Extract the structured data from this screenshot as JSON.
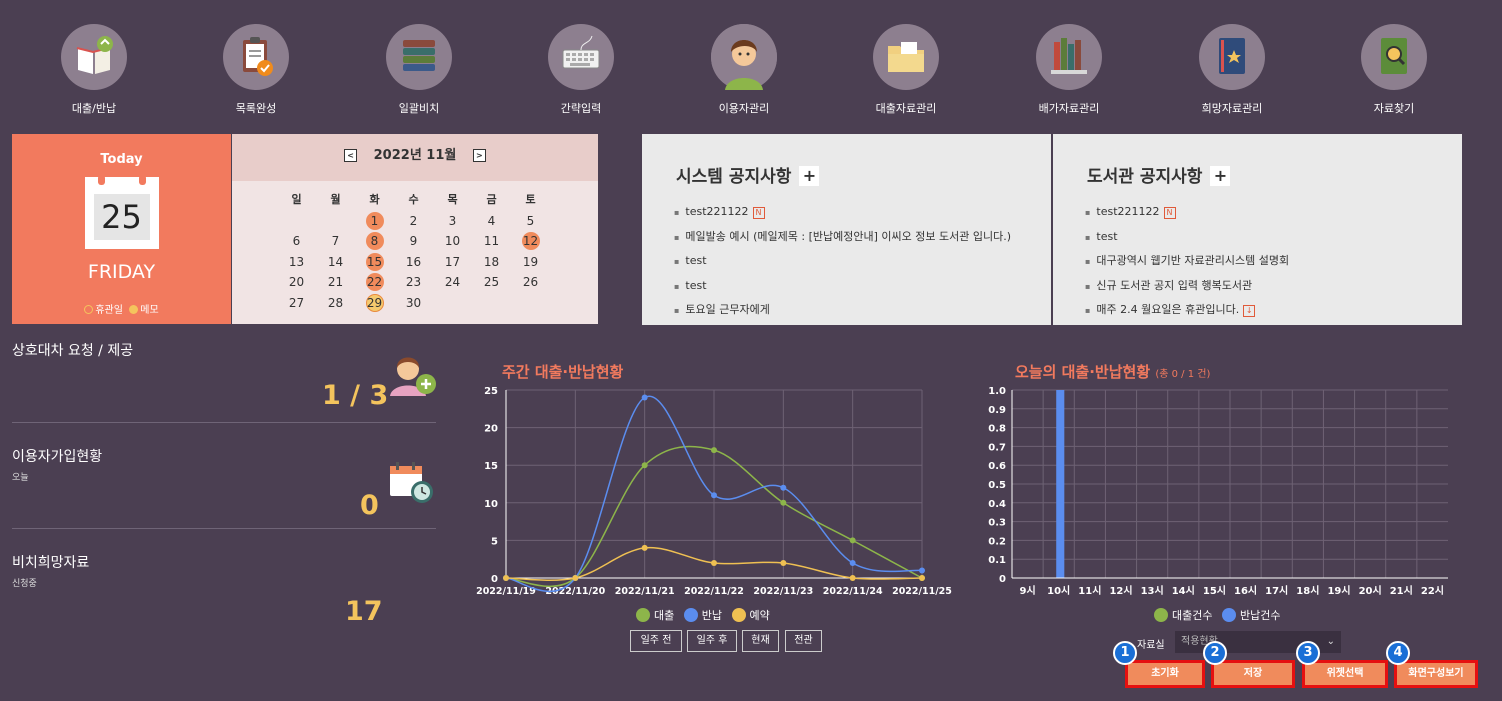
{
  "nav": [
    {
      "label": "대출/반납",
      "icon": "book-return-icon"
    },
    {
      "label": "목록완성",
      "icon": "clipboard-check-icon"
    },
    {
      "label": "일괄비치",
      "icon": "book-stack-icon"
    },
    {
      "label": "간략입력",
      "icon": "keyboard-icon"
    },
    {
      "label": "이용자관리",
      "icon": "user-avatar-icon"
    },
    {
      "label": "대출자료관리",
      "icon": "folder-icon"
    },
    {
      "label": "배가자료관리",
      "icon": "bookshelf-icon"
    },
    {
      "label": "희망자료관리",
      "icon": "star-book-icon"
    },
    {
      "label": "자료찾기",
      "icon": "book-search-icon"
    }
  ],
  "today": {
    "title": "Today",
    "date": "25",
    "weekday": "FRIDAY",
    "legend_holiday": "휴관일",
    "legend_memo": "메모"
  },
  "calendar": {
    "month": "2022년 11월",
    "prev_icon": "<",
    "next_icon": ">",
    "weekdays": [
      "일",
      "월",
      "화",
      "수",
      "목",
      "금",
      "토"
    ],
    "days": [
      [
        "",
        "",
        "1",
        "2",
        "3",
        "4",
        "5"
      ],
      [
        "6",
        "7",
        "8",
        "9",
        "10",
        "11",
        "12"
      ],
      [
        "13",
        "14",
        "15",
        "16",
        "17",
        "18",
        "19"
      ],
      [
        "20",
        "21",
        "22",
        "23",
        "24",
        "25",
        "26"
      ],
      [
        "27",
        "28",
        "29",
        "30",
        "",
        "",
        ""
      ]
    ],
    "holiday_days": [
      "1",
      "8",
      "12",
      "15",
      "22"
    ],
    "memo_days": [
      "29"
    ]
  },
  "system_notice": {
    "title": "시스템 공지사항",
    "plus": "+",
    "items": [
      {
        "text": "test221122",
        "tag": "N"
      },
      {
        "text": "메일발송 예시 (메일제목 : [반납예정안내] 이씨오 정보 도서관 입니다.)",
        "tag": ""
      },
      {
        "text": "test",
        "tag": ""
      },
      {
        "text": "test",
        "tag": ""
      },
      {
        "text": "토요일 근무자에게",
        "tag": ""
      }
    ]
  },
  "library_notice": {
    "title": "도서관 공지사항",
    "plus": "+",
    "items": [
      {
        "text": "test221122",
        "tag": "N"
      },
      {
        "text": "test",
        "tag": ""
      },
      {
        "text": "대구광역시 웹기반 자료관리시스템 설명회",
        "tag": ""
      },
      {
        "text": "신규 도서관 공지 입력 행복도서관",
        "tag": ""
      },
      {
        "text": "매주 2.4 월요일은 휴관입니다.",
        "tag": "↓"
      }
    ]
  },
  "stats": {
    "interlibrary": {
      "title": "상호대차 요청 / 제공",
      "value": "1 / 3"
    },
    "signup": {
      "title": "이용자가입현황",
      "sub": "오늘",
      "value": "0"
    },
    "wish": {
      "title": "비치희망자료",
      "sub": "신청중",
      "value": "17"
    }
  },
  "weekly_chart": {
    "title": "주간 대출·반납현황",
    "buttons": [
      "일주 전",
      "일주 후",
      "현재",
      "전관"
    ]
  },
  "today_chart": {
    "title": "오늘의 대출·반납현황",
    "subtitle": "(총 0 / 1 건)"
  },
  "filter": {
    "label": "자료실",
    "value": "적용현황"
  },
  "actions": [
    {
      "label": "초기화",
      "badge": "1"
    },
    {
      "label": "저장",
      "badge": "2"
    },
    {
      "label": "위젯선택",
      "badge": "3"
    },
    {
      "label": "화면구성보기",
      "badge": "4"
    }
  ],
  "colors": {
    "loan": "#8db54a",
    "return": "#5b8def",
    "reserve": "#efc052",
    "accent": "#f27a5e"
  },
  "chart_data": [
    {
      "type": "line",
      "title": "주간 대출·반납현황",
      "x": [
        "2022/11/19",
        "2022/11/20",
        "2022/11/21",
        "2022/11/22",
        "2022/11/23",
        "2022/11/24",
        "2022/11/25"
      ],
      "ylim": [
        0,
        25
      ],
      "yticks": [
        0,
        5,
        10,
        15,
        20,
        25
      ],
      "grid": true,
      "legend": "bottom",
      "series": [
        {
          "name": "대출",
          "color": "#8db54a",
          "values": [
            0,
            0,
            15,
            17,
            10,
            5,
            0
          ]
        },
        {
          "name": "반납",
          "color": "#5b8def",
          "values": [
            0,
            0,
            24,
            11,
            12,
            2,
            1
          ]
        },
        {
          "name": "예약",
          "color": "#efc052",
          "values": [
            0,
            0,
            4,
            2,
            2,
            0,
            0
          ]
        }
      ]
    },
    {
      "type": "bar",
      "title": "오늘의 대출·반납현황",
      "categories": [
        "9시",
        "10시",
        "11시",
        "12시",
        "13시",
        "14시",
        "15시",
        "16시",
        "17시",
        "18시",
        "19시",
        "20시",
        "21시",
        "22시"
      ],
      "ylim": [
        0,
        1.0
      ],
      "yticks": [
        "0",
        "0.1",
        "0.2",
        "0.3",
        "0.4",
        "0.5",
        "0.6",
        "0.7",
        "0.8",
        "0.9",
        "1.0"
      ],
      "grid": true,
      "legend": "bottom",
      "series": [
        {
          "name": "대출건수",
          "color": "#8db54a",
          "values": [
            0,
            0,
            0,
            0,
            0,
            0,
            0,
            0,
            0,
            0,
            0,
            0,
            0,
            0
          ]
        },
        {
          "name": "반납건수",
          "color": "#5b8def",
          "values": [
            0,
            1,
            0,
            0,
            0,
            0,
            0,
            0,
            0,
            0,
            0,
            0,
            0,
            0
          ]
        }
      ]
    }
  ]
}
